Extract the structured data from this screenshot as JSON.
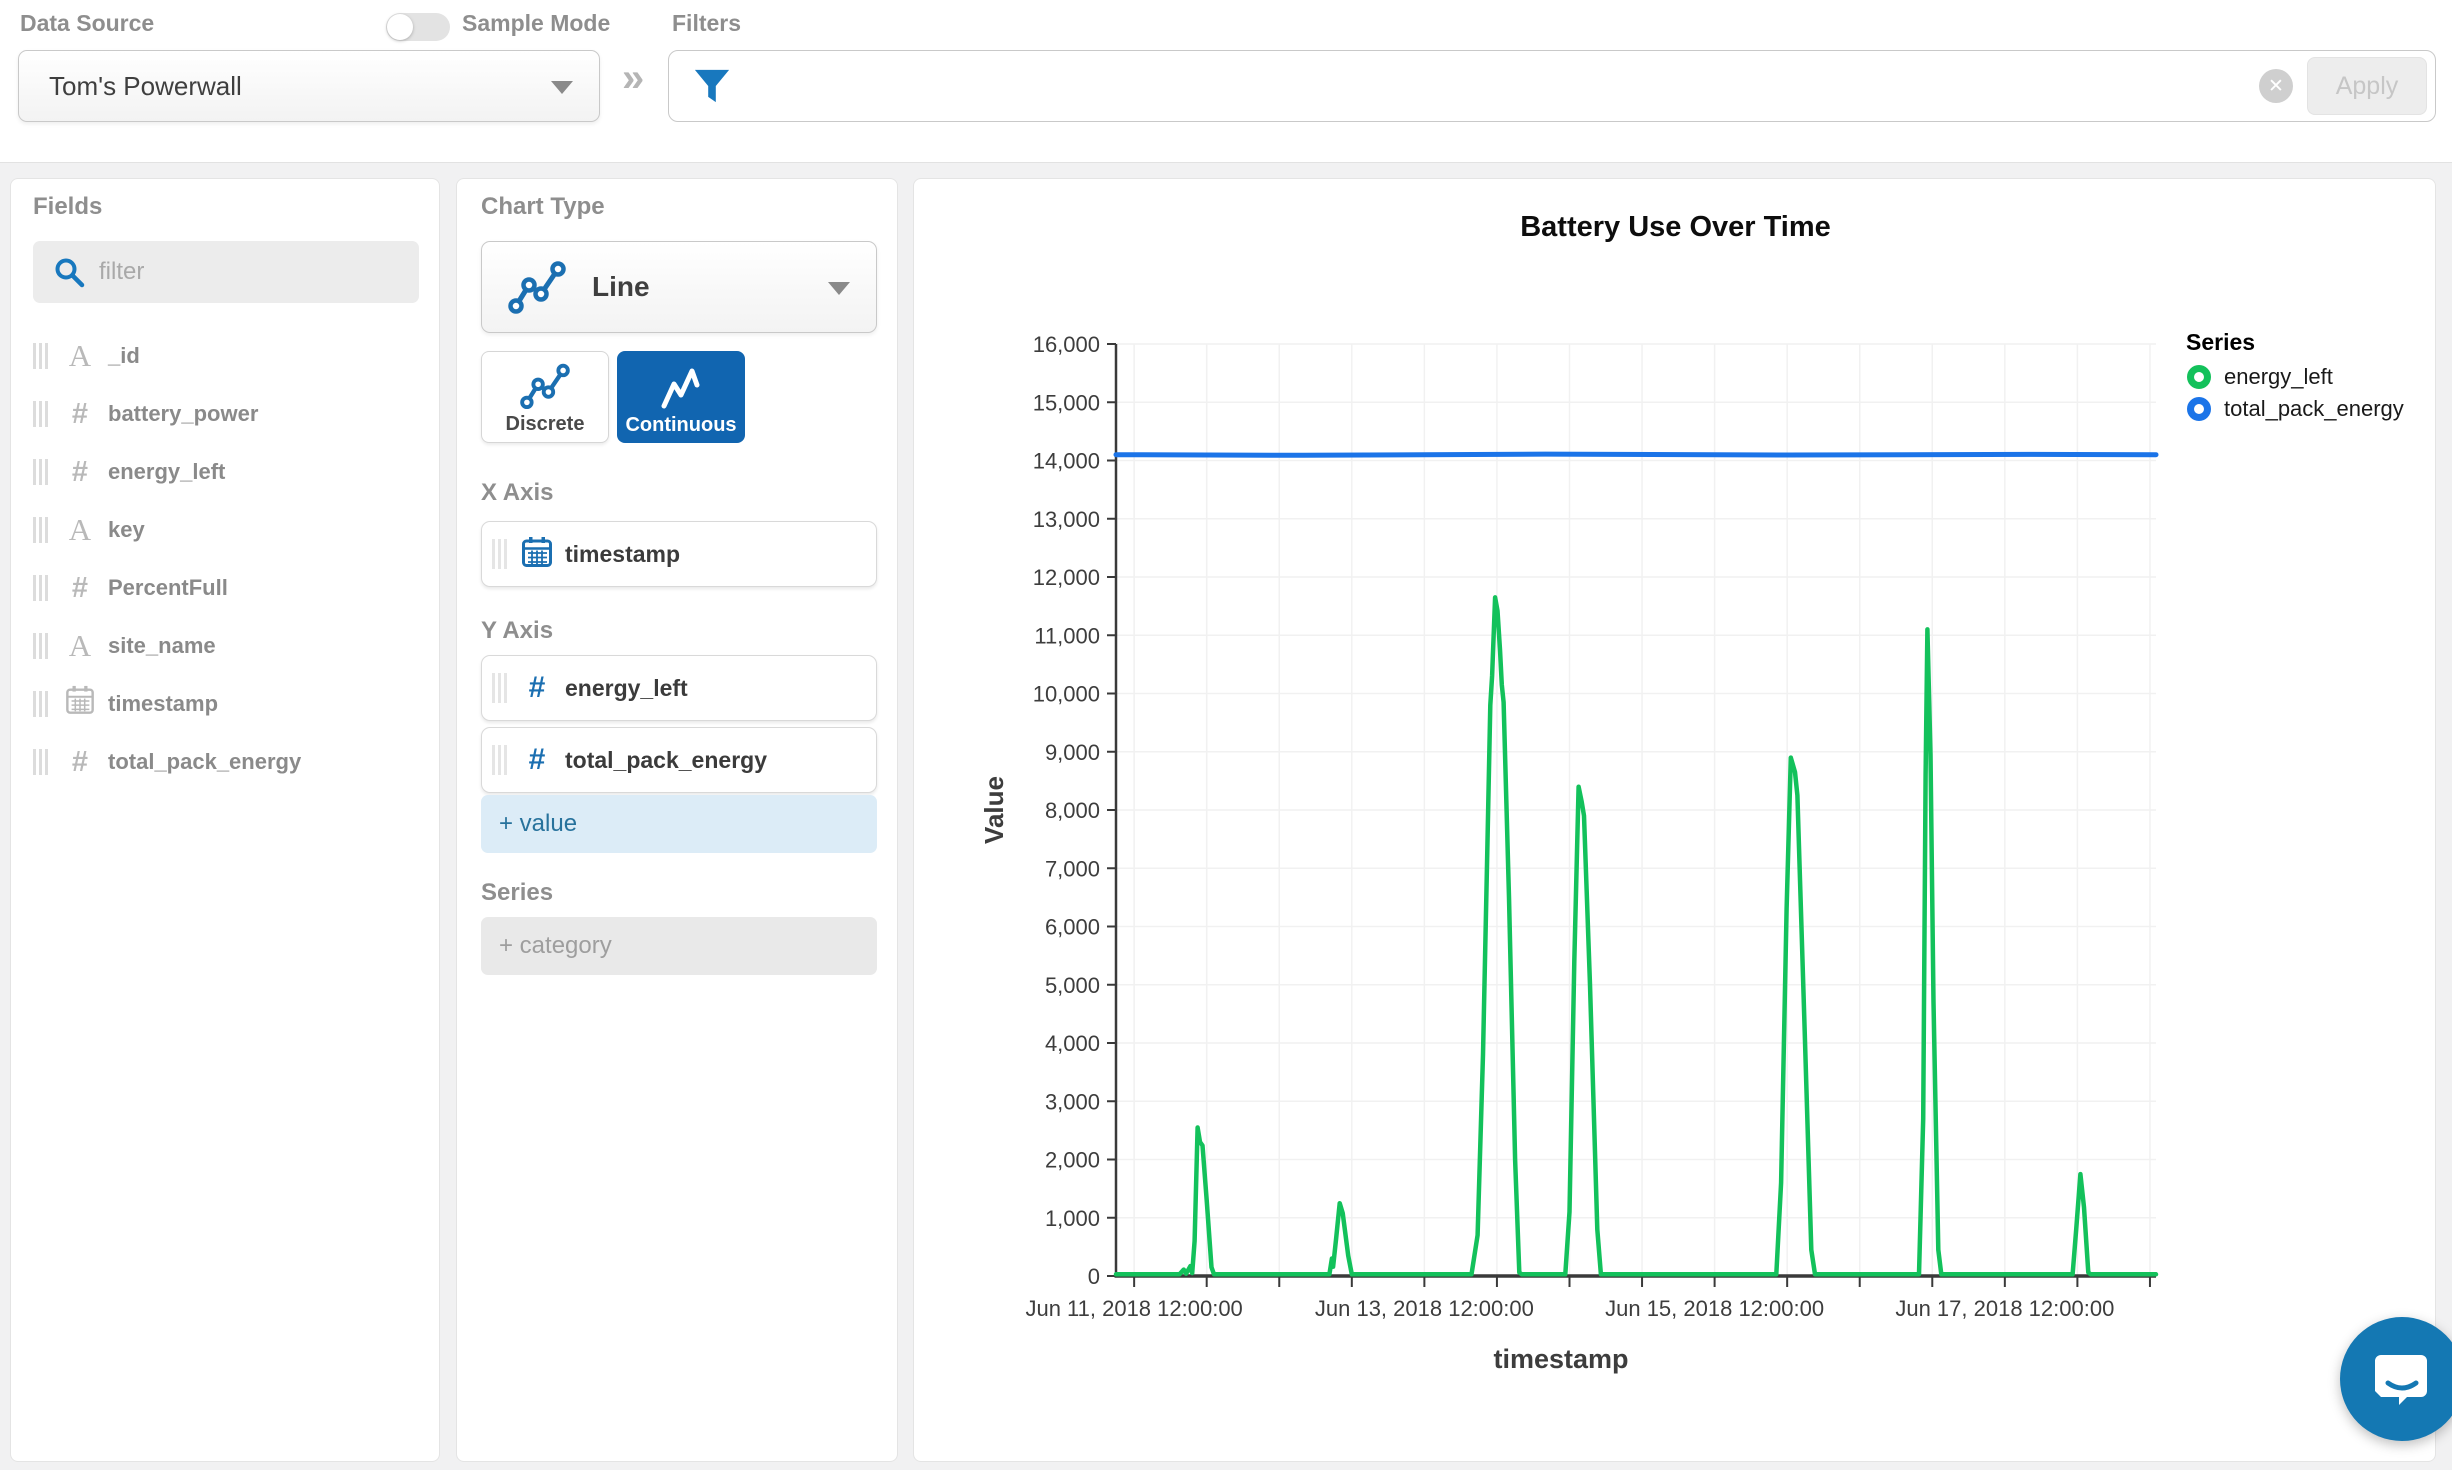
{
  "top_bar": {
    "data_source_label": "Data Source",
    "data_source_value": "Tom's Powerwall",
    "sample_mode_label": "Sample Mode",
    "sample_mode_on": false,
    "chevron_separator": "»",
    "filters_label": "Filters",
    "filter_value": "",
    "clear_icon_glyph": "✕",
    "apply_label": "Apply"
  },
  "fields_panel": {
    "title": "Fields",
    "filter_placeholder": "filter",
    "items": [
      {
        "name": "_id",
        "type": "string",
        "icon_char": "A"
      },
      {
        "name": "battery_power",
        "type": "number",
        "icon_char": "#"
      },
      {
        "name": "energy_left",
        "type": "number",
        "icon_char": "#"
      },
      {
        "name": "key",
        "type": "string",
        "icon_char": "A"
      },
      {
        "name": "PercentFull",
        "type": "number",
        "icon_char": "#"
      },
      {
        "name": "site_name",
        "type": "string",
        "icon_char": "A"
      },
      {
        "name": "timestamp",
        "type": "date",
        "icon_char": ""
      },
      {
        "name": "total_pack_energy",
        "type": "number",
        "icon_char": "#"
      }
    ]
  },
  "builder_panel": {
    "chart_type_label": "Chart Type",
    "chart_type_value": "Line",
    "mode_discrete_label": "Discrete",
    "mode_continuous_label": "Continuous",
    "selected_mode": "Continuous",
    "x_axis_label": "X Axis",
    "x_axis_field": {
      "name": "timestamp",
      "type": "date"
    },
    "y_axis_label": "Y Axis",
    "y_axis_fields": [
      {
        "name": "energy_left",
        "icon_char": "#"
      },
      {
        "name": "total_pack_energy",
        "icon_char": "#"
      }
    ],
    "add_value_label": "+ value",
    "series_label": "Series",
    "add_category_label": "+ category"
  },
  "chart_data": {
    "type": "line",
    "title": "Battery Use Over Time",
    "xlabel": "timestamp",
    "ylabel": "Value",
    "ylim": [
      0,
      16000
    ],
    "y_tick_step": 1000,
    "x_encoding": "hours since Jun 11, 2018 00:00",
    "x_domain_hours": [
      9,
      181
    ],
    "minor_tick_hours": 12,
    "grid": true,
    "legend_title": "Series",
    "legend_position": "right",
    "x_ticks": [
      {
        "t": 12,
        "label": "Jun 11, 2018 12:00:00"
      },
      {
        "t": 60,
        "label": "Jun 13, 2018 12:00:00"
      },
      {
        "t": 108,
        "label": "Jun 15, 2018 12:00:00"
      },
      {
        "t": 156,
        "label": "Jun 17, 2018 12:00:00"
      }
    ],
    "series": [
      {
        "name": "energy_left",
        "color": "#13c15b",
        "width": 4.5,
        "points": [
          [
            9,
            30
          ],
          [
            19.5,
            30
          ],
          [
            20.2,
            110
          ],
          [
            20.6,
            40
          ],
          [
            21.3,
            170
          ],
          [
            21.6,
            50
          ],
          [
            22.0,
            600
          ],
          [
            22.5,
            2550
          ],
          [
            22.9,
            2300
          ],
          [
            23.3,
            2240
          ],
          [
            24.0,
            1300
          ],
          [
            24.8,
            150
          ],
          [
            25.2,
            30
          ],
          [
            44.3,
            30
          ],
          [
            44.7,
            300
          ],
          [
            44.9,
            160
          ],
          [
            45.4,
            640
          ],
          [
            46.0,
            1250
          ],
          [
            46.5,
            1080
          ],
          [
            47.4,
            350
          ],
          [
            48.0,
            30
          ],
          [
            67.8,
            30
          ],
          [
            68.8,
            700
          ],
          [
            69.7,
            3800
          ],
          [
            70.4,
            7300
          ],
          [
            70.9,
            9800
          ],
          [
            71.2,
            10300
          ],
          [
            71.7,
            11650
          ],
          [
            72.1,
            11420
          ],
          [
            72.5,
            10750
          ],
          [
            72.8,
            10150
          ],
          [
            73.1,
            9850
          ],
          [
            74.0,
            6500
          ],
          [
            75.0,
            2000
          ],
          [
            75.7,
            60
          ],
          [
            76.1,
            30
          ],
          [
            83.3,
            30
          ],
          [
            84.0,
            1100
          ],
          [
            84.8,
            5400
          ],
          [
            85.5,
            8400
          ],
          [
            86.0,
            8150
          ],
          [
            86.4,
            7900
          ],
          [
            87.4,
            5000
          ],
          [
            88.6,
            800
          ],
          [
            89.2,
            30
          ],
          [
            118.2,
            30
          ],
          [
            119.0,
            1600
          ],
          [
            119.9,
            6300
          ],
          [
            120.6,
            8900
          ],
          [
            121.3,
            8650
          ],
          [
            121.7,
            8250
          ],
          [
            122.9,
            4200
          ],
          [
            124.0,
            450
          ],
          [
            124.6,
            30
          ],
          [
            141.8,
            30
          ],
          [
            142.5,
            2700
          ],
          [
            142.9,
            8600
          ],
          [
            143.2,
            11100
          ],
          [
            143.7,
            8950
          ],
          [
            144.2,
            4700
          ],
          [
            145.0,
            450
          ],
          [
            145.5,
            30
          ],
          [
            167.2,
            30
          ],
          [
            167.8,
            800
          ],
          [
            168.5,
            1750
          ],
          [
            169.1,
            1180
          ],
          [
            169.8,
            60
          ],
          [
            170.2,
            30
          ],
          [
            181,
            30
          ]
        ]
      },
      {
        "name": "total_pack_energy",
        "color": "#1b74e8",
        "width": 5,
        "points": [
          [
            9,
            14100
          ],
          [
            40,
            14090
          ],
          [
            80,
            14110
          ],
          [
            120,
            14095
          ],
          [
            160,
            14105
          ],
          [
            181,
            14100
          ]
        ]
      }
    ]
  },
  "colors": {
    "accent_blue": "#1b6fb1",
    "selected_button_blue": "#1165b0",
    "icon_blue": "#1878be",
    "chart_green": "#13c15b",
    "chart_blue": "#1b74e8",
    "intercom_blue": "#1478b3"
  }
}
